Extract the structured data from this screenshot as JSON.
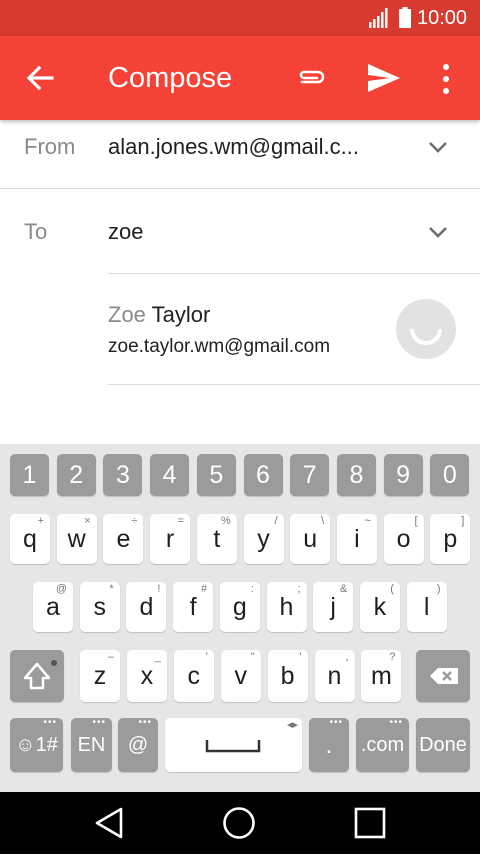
{
  "status_bar": {
    "time": "10:00",
    "signal_icon": "signal-icon",
    "battery_icon": "battery-icon"
  },
  "app_bar": {
    "title": "Compose",
    "back_icon": "arrow-back-icon",
    "attach_icon": "attach-icon",
    "send_icon": "send-icon",
    "more_icon": "more-vert-icon"
  },
  "from": {
    "label": "From",
    "value": "alan.jones.wm@gmail.c..."
  },
  "to": {
    "label": "To",
    "value": "zoe"
  },
  "suggestion": {
    "name_match": "Zoe",
    "name_rest": " Taylor",
    "email": "zoe.taylor.wm@gmail.com"
  },
  "keyboard": {
    "numbers": [
      "1",
      "2",
      "3",
      "4",
      "5",
      "6",
      "7",
      "8",
      "9",
      "0"
    ],
    "row1": [
      {
        "k": "q",
        "h": "+"
      },
      {
        "k": "w",
        "h": "×"
      },
      {
        "k": "e",
        "h": "÷"
      },
      {
        "k": "r",
        "h": "="
      },
      {
        "k": "t",
        "h": "%"
      },
      {
        "k": "y",
        "h": "/"
      },
      {
        "k": "u",
        "h": "\\"
      },
      {
        "k": "i",
        "h": "~"
      },
      {
        "k": "o",
        "h": "["
      },
      {
        "k": "p",
        "h": "]"
      }
    ],
    "row2": [
      {
        "k": "a",
        "h": "@"
      },
      {
        "k": "s",
        "h": "*"
      },
      {
        "k": "d",
        "h": "!"
      },
      {
        "k": "f",
        "h": "#"
      },
      {
        "k": "g",
        "h": ":"
      },
      {
        "k": "h",
        "h": ";"
      },
      {
        "k": "j",
        "h": "&"
      },
      {
        "k": "k",
        "h": "("
      },
      {
        "k": "l",
        "h": ")"
      }
    ],
    "row3": [
      {
        "k": "z",
        "h": "–"
      },
      {
        "k": "x",
        "h": "_"
      },
      {
        "k": "c",
        "h": "'"
      },
      {
        "k": "v",
        "h": "\""
      },
      {
        "k": "b",
        "h": "'"
      },
      {
        "k": "n",
        "h": ","
      },
      {
        "k": "m",
        "h": "?"
      }
    ],
    "emoji_label": "☺1#",
    "lang_label": "EN",
    "at_label": "@",
    "dot_label": ".",
    "com_label": ".com",
    "done_label": "Done"
  }
}
